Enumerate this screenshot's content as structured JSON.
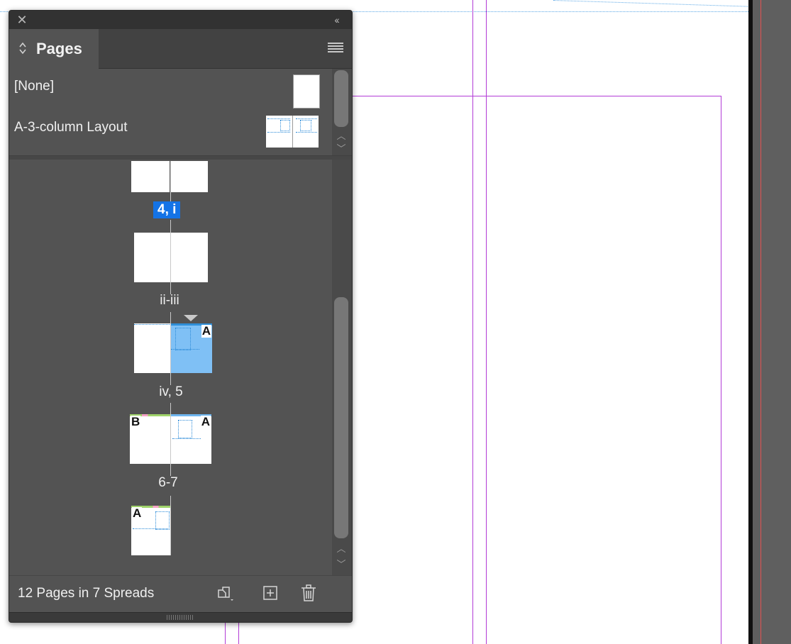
{
  "panel": {
    "title": "Pages",
    "masters": [
      {
        "label": "[None]"
      },
      {
        "label": "A-3-column Layout"
      }
    ],
    "spreads": [
      {
        "label": "4, i",
        "selected": true,
        "master_letters": []
      },
      {
        "label": "ii-iii",
        "selected": false,
        "master_letters": []
      },
      {
        "label": "iv, 5",
        "selected": false,
        "master_letters": [
          "A"
        ]
      },
      {
        "label": "6-7",
        "selected": false,
        "master_letters": [
          "B",
          "A"
        ]
      },
      {
        "label": "",
        "selected": false,
        "master_letters": [
          "A"
        ]
      }
    ],
    "status": "12 Pages in 7 Spreads",
    "selected_page_color": "#7fc0f5",
    "selection_accent": "#1473e6",
    "guide_color": "#b23bd6",
    "icons": {
      "close": "close-icon",
      "collapse": "collapse-double-chevron-icon",
      "menu": "panel-menu-icon",
      "edit_page_size": "edit-page-size-icon",
      "new_page": "new-page-icon",
      "delete": "trash-icon"
    }
  }
}
